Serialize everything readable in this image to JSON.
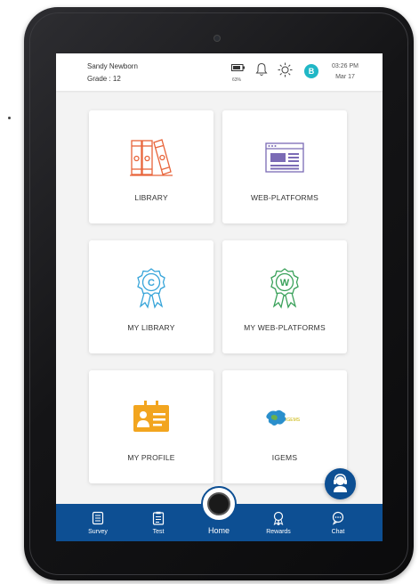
{
  "header": {
    "user_name": "Sandy Newborn",
    "grade": "Grade : 12",
    "battery": "63%",
    "avatar_letter": "B",
    "time": "03:26 PM",
    "date": "Mar 17"
  },
  "tiles": [
    {
      "label": "LIBRARY",
      "icon": "binders-icon"
    },
    {
      "label": "WEB-PLATFORMS",
      "icon": "web-page-icon"
    },
    {
      "label": "MY LIBRARY",
      "icon": "award-c-icon"
    },
    {
      "label": "MY WEB-PLATFORMS",
      "icon": "award-w-icon"
    },
    {
      "label": "MY PROFILE",
      "icon": "id-card-icon"
    },
    {
      "label": "IGEMS",
      "icon": "igems-logo",
      "logo_text": "IGEMS"
    }
  ],
  "nav": {
    "items": [
      {
        "label": "Survey",
        "icon": "survey-icon"
      },
      {
        "label": "Test",
        "icon": "test-icon"
      },
      {
        "label": "Home",
        "icon": "home-icon"
      },
      {
        "label": "Rewards",
        "icon": "rewards-icon"
      },
      {
        "label": "Chat",
        "icon": "chat-icon"
      }
    ]
  },
  "colors": {
    "primary": "#0d4f93",
    "library": "#e8643a",
    "web": "#7b6bb5",
    "my_library": "#36a4d9",
    "my_web": "#3aa15a",
    "profile": "#f2a51f",
    "avatar": "#20b7c6"
  }
}
